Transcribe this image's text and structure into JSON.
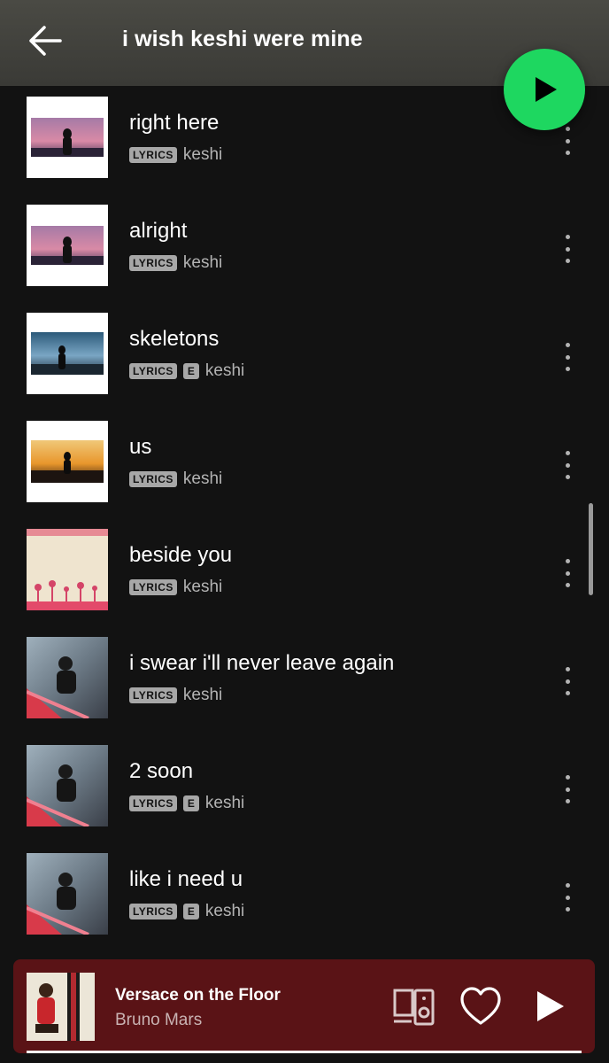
{
  "header": {
    "title": "i wish keshi were mine"
  },
  "tracks": [
    {
      "title": "right here",
      "lyrics": "LYRICS",
      "explicit": "",
      "artist": "keshi",
      "art": "sunset-purple"
    },
    {
      "title": "alright",
      "lyrics": "LYRICS",
      "explicit": "",
      "artist": "keshi",
      "art": "sunset-purple"
    },
    {
      "title": "skeletons",
      "lyrics": "LYRICS",
      "explicit": "E",
      "artist": "keshi",
      "art": "blue-sky"
    },
    {
      "title": "us",
      "lyrics": "LYRICS",
      "explicit": "",
      "artist": "keshi",
      "art": "golden-sunset"
    },
    {
      "title": "beside you",
      "lyrics": "LYRICS",
      "explicit": "",
      "artist": "keshi",
      "art": "pink-palms"
    },
    {
      "title": "i swear i'll never leave again",
      "lyrics": "LYRICS",
      "explicit": "",
      "artist": "keshi",
      "art": "stairs-photo"
    },
    {
      "title": "2 soon",
      "lyrics": "LYRICS",
      "explicit": "E",
      "artist": "keshi",
      "art": "stairs-photo"
    },
    {
      "title": "like i need u",
      "lyrics": "LYRICS",
      "explicit": "E",
      "artist": "keshi",
      "art": "stairs-photo"
    }
  ],
  "now_playing": {
    "title": "Versace on the Floor",
    "artist": "Bruno Mars",
    "progress": 1.0
  },
  "colors": {
    "accent": "#1ed760",
    "background": "#121212",
    "now_playing_bg": "#5a1316"
  },
  "icons": {
    "back": "arrow-left-icon",
    "play": "play-icon",
    "more": "more-vertical-icon",
    "devices": "devices-icon",
    "heart": "heart-icon"
  }
}
